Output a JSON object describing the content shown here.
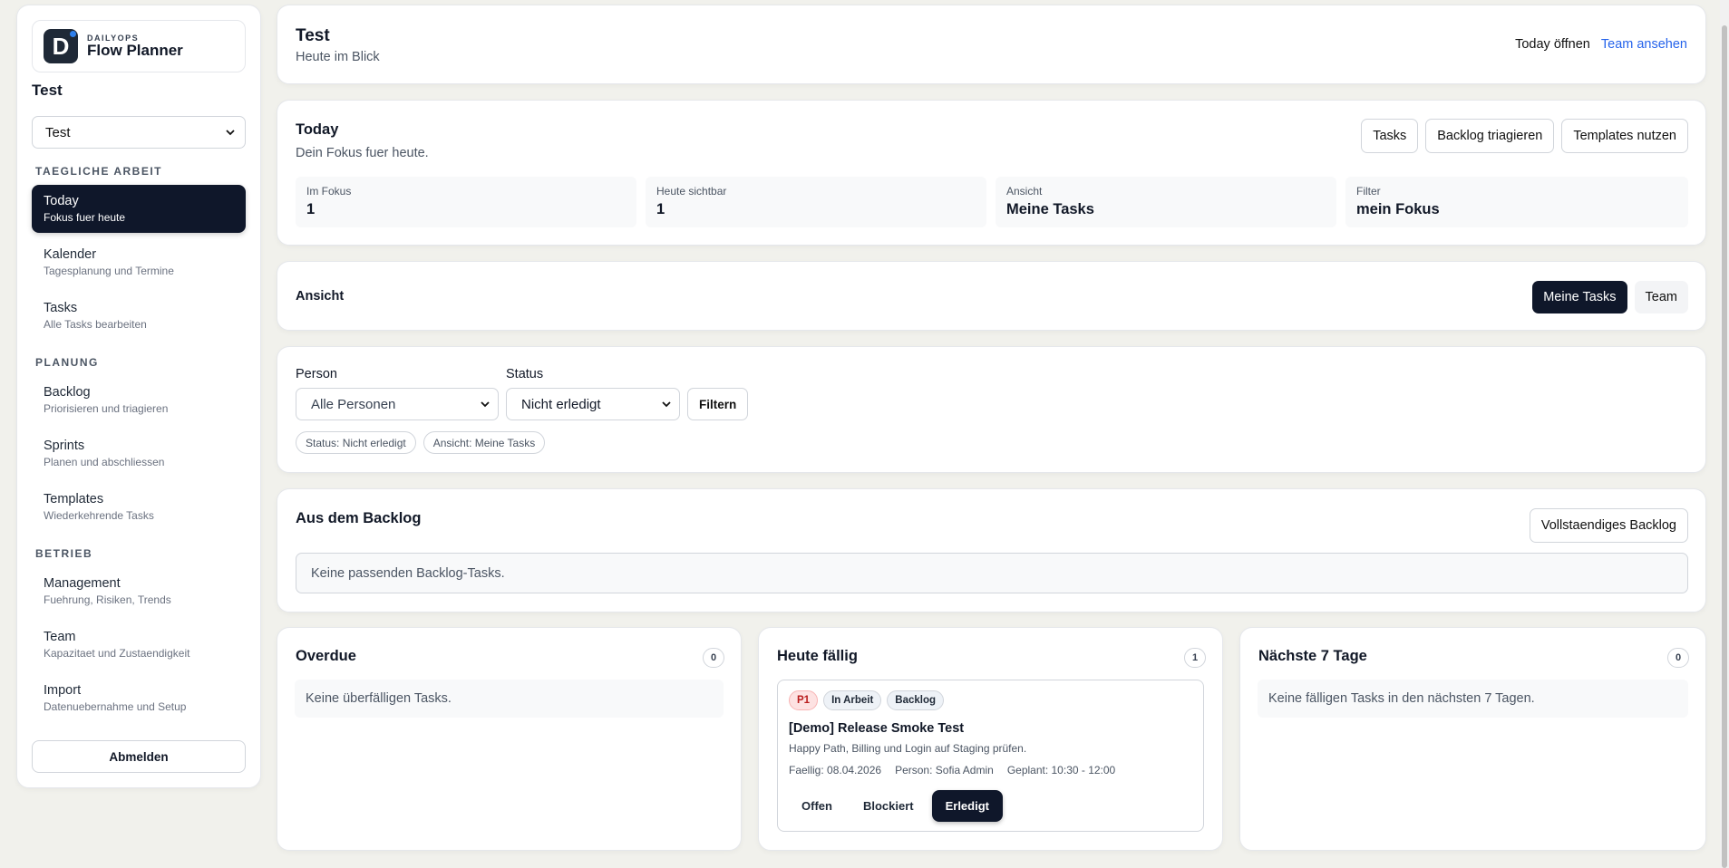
{
  "sidebar": {
    "brand_over": "DAILYOPS",
    "brand_name": "Flow Planner",
    "logo_letter": "D",
    "workspace_title": "Test",
    "workspace_select": "Test",
    "sections": {
      "daily": "TAEGLICHE ARBEIT",
      "planning": "PLANUNG",
      "operation": "BETRIEB"
    },
    "items": [
      {
        "title": "Today",
        "sub": "Fokus fuer heute"
      },
      {
        "title": "Kalender",
        "sub": "Tagesplanung und Termine"
      },
      {
        "title": "Tasks",
        "sub": "Alle Tasks bearbeiten"
      },
      {
        "title": "Backlog",
        "sub": "Priorisieren und triagieren"
      },
      {
        "title": "Sprints",
        "sub": "Planen und abschliessen"
      },
      {
        "title": "Templates",
        "sub": "Wiederkehrende Tasks"
      },
      {
        "title": "Management",
        "sub": "Fuehrung, Risiken, Trends"
      },
      {
        "title": "Team",
        "sub": "Kapazitaet und Zustaendigkeit"
      },
      {
        "title": "Import",
        "sub": "Datenuebernahme und Setup"
      }
    ],
    "logout": "Abmelden"
  },
  "header": {
    "title": "Test",
    "subtitle": "Heute im Blick",
    "link_today": "Today öffnen",
    "link_team": "Team ansehen"
  },
  "today": {
    "title": "Today",
    "subtitle": "Dein Fokus fuer heute.",
    "buttons": {
      "tasks": "Tasks",
      "triage": "Backlog triagieren",
      "templates": "Templates nutzen"
    },
    "stats": [
      {
        "label": "Im Fokus",
        "value": "1"
      },
      {
        "label": "Heute sichtbar",
        "value": "1"
      },
      {
        "label": "Ansicht",
        "value": "Meine Tasks"
      },
      {
        "label": "Filter",
        "value": "mein Fokus"
      }
    ]
  },
  "view": {
    "label": "Ansicht",
    "my_tasks": "Meine Tasks",
    "team": "Team"
  },
  "filter": {
    "person_label": "Person",
    "person_value": "Alle Personen",
    "status_label": "Status",
    "status_value": "Nicht erledigt",
    "submit": "Filtern",
    "chip_status": "Status: Nicht erledigt",
    "chip_view": "Ansicht: Meine Tasks"
  },
  "backlog": {
    "title": "Aus dem Backlog",
    "button": "Vollstaendiges Backlog",
    "empty": "Keine passenden Backlog-Tasks."
  },
  "overdue": {
    "title": "Overdue",
    "count": "0",
    "empty": "Keine überfälligen Tasks."
  },
  "due_today": {
    "title": "Heute fällig",
    "count": "1",
    "task": {
      "tag_priority": "P1",
      "tag_status": "In Arbeit",
      "tag_source": "Backlog",
      "title": "[Demo] Release Smoke Test",
      "description": "Happy Path, Billing und Login auf Staging prüfen.",
      "due": "Faellig: 08.04.2026",
      "person": "Person: Sofia Admin",
      "planned": "Geplant: 10:30 - 12:00",
      "actions": {
        "open": "Offen",
        "blocked": "Blockiert",
        "done": "Erledigt"
      }
    }
  },
  "next7": {
    "title": "Nächste 7 Tage",
    "count": "0",
    "empty": "Keine fälligen Tasks in den nächsten 7 Tagen."
  },
  "colors": {
    "accent_link": "#2563eb",
    "dark": "#0f172a",
    "p1_bg": "#fde2e2",
    "p1_fg": "#b91c1c"
  }
}
